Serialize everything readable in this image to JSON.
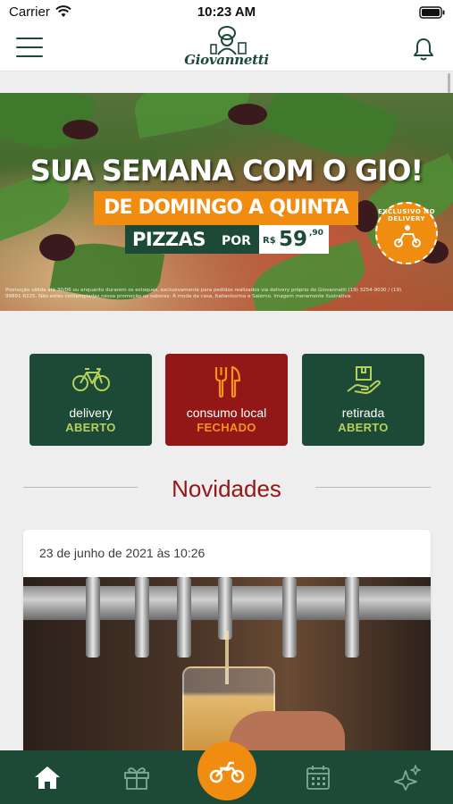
{
  "status_bar": {
    "carrier": "Carrier",
    "time": "10:23 AM"
  },
  "header": {
    "logo_text": "Giovannetti"
  },
  "banner": {
    "title": "SUA SEMANA COM O GIO!",
    "subtitle": "DE DOMINGO A QUINTA",
    "price_item": "PIZZAS",
    "price_por": "POR",
    "price_currency": "R$",
    "price_value": "59",
    "price_cents": ",90",
    "stamp_text": "EXCLUSIVO NO DELIVERY",
    "fine_print": "Promoção válida até 30/06 ou enquanto durarem os estoques, exclusivamente para pedidos realizados via delivery próprio do Giovannetti (19) 3254-9030 / (19) 99891-8225. Não estão contempladas nessa promoção os sabores: À moda da casa, Italianíssima e Salerno. Imagem meramente ilustrativa."
  },
  "services": [
    {
      "label": "delivery",
      "status": "ABERTO",
      "icon": "bicycle-icon"
    },
    {
      "label": "consumo local",
      "status": "FECHADO",
      "icon": "fork-knife-icon"
    },
    {
      "label": "retirada",
      "status": "ABERTO",
      "icon": "package-hand-icon"
    }
  ],
  "news": {
    "section_title": "Novidades",
    "items": [
      {
        "date": "23 de junho de 2021 às 10:26"
      }
    ]
  },
  "tabbar": {
    "items": [
      "home-icon",
      "gift-icon",
      "motorcycle-icon",
      "calendar-icon",
      "sparkles-icon"
    ],
    "active": "home-icon"
  },
  "colors": {
    "brand_green": "#1d4a37",
    "brand_red": "#931716",
    "accent_orange": "#f08c10",
    "open_green": "#b6d15a"
  }
}
